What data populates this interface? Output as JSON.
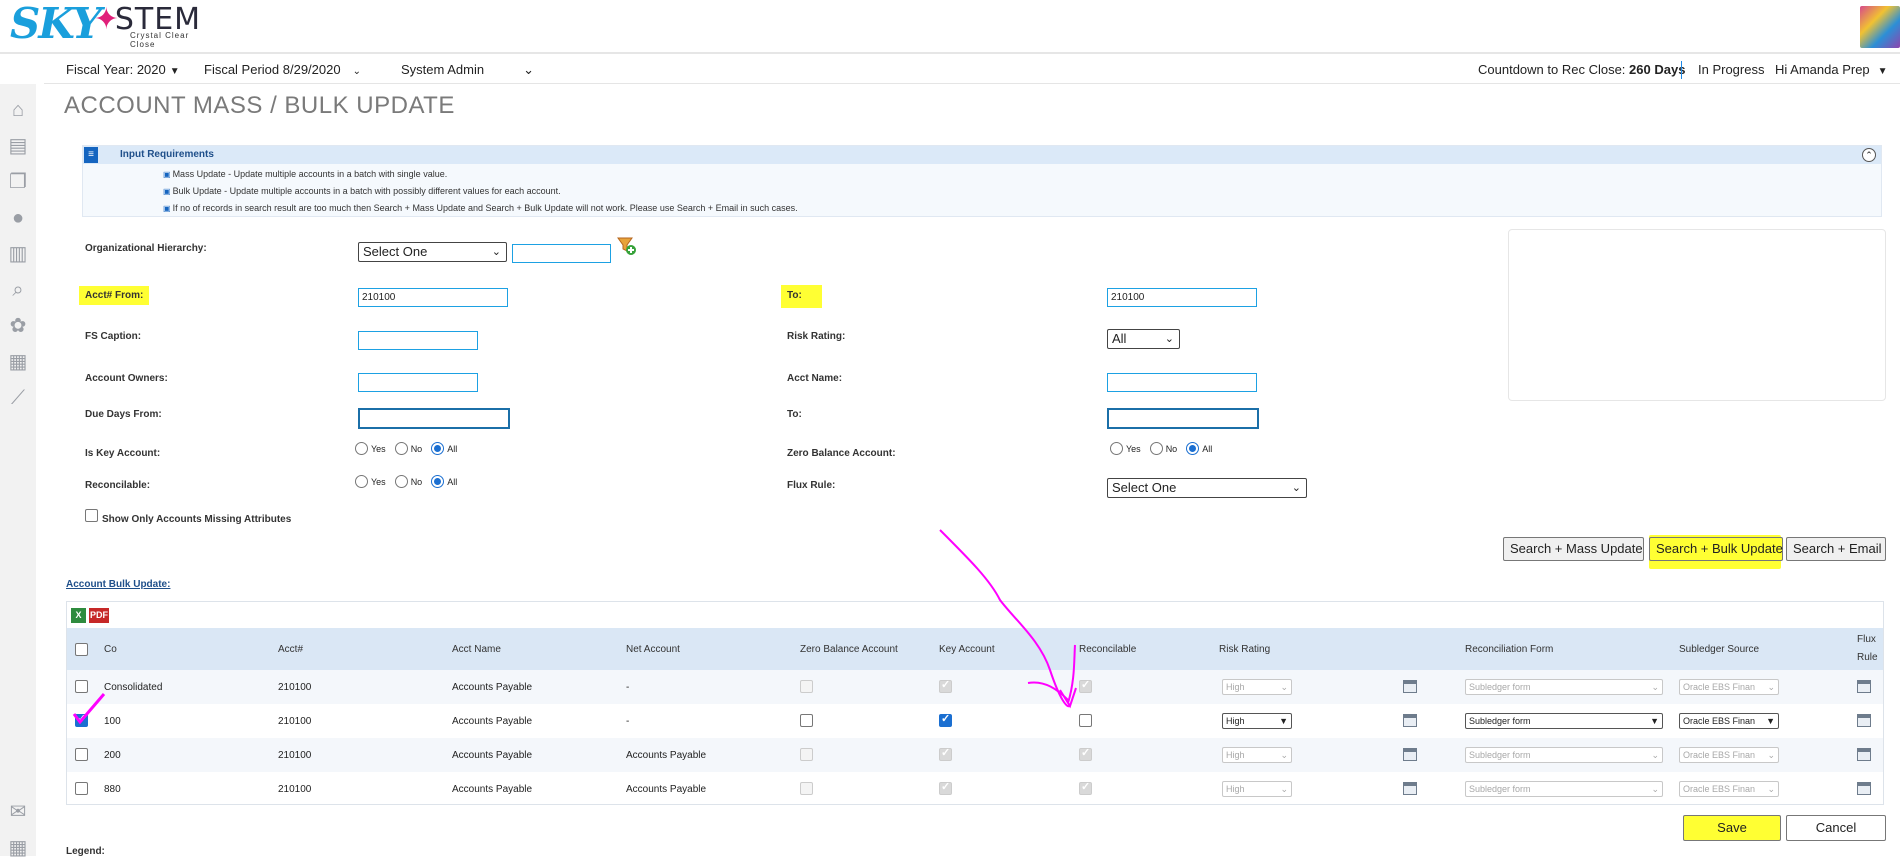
{
  "brand": {
    "logo_part1": "SKY",
    "logo_part2": "STEM",
    "tagline": "Crystal Clear Close"
  },
  "nav": {
    "fiscal_year": "Fiscal Year: 2020",
    "fiscal_period": "Fiscal Period  8/29/2020",
    "role": "System Admin",
    "countdown_label": "Countdown to Rec Close:",
    "countdown_value": "260 Days",
    "status": "In Progress",
    "greeting": "Hi Amanda Prep"
  },
  "page_title": "ACCOUNT MASS / BULK UPDATE",
  "input_requirements": {
    "title": "Input Requirements",
    "lines": [
      "Mass Update - Update multiple accounts in a batch with single value.",
      "Bulk Update - Update multiple accounts in a batch with possibly different values for each account.",
      "If no of records in search result are too much then Search + Mass Update and Search + Bulk Update will not work. Please use Search + Email in such cases."
    ]
  },
  "form": {
    "org_hierarchy_label": "Organizational Hierarchy:",
    "org_hierarchy_value": "Select One",
    "acct_from_label": "Acct# From:",
    "acct_from_value": "210100",
    "acct_to_label": "To:",
    "acct_to_value": "210100",
    "fs_caption_label": "FS Caption:",
    "risk_rating_label": "Risk Rating:",
    "risk_rating_value": "All",
    "account_owners_label": "Account Owners:",
    "acct_name_label": "Acct Name:",
    "due_days_from_label": "Due Days From:",
    "due_days_to_label": "To:",
    "is_key_account_label": "Is Key Account:",
    "zero_balance_label": "Zero Balance Account:",
    "reconcilable_label": "Reconcilable:",
    "flux_rule_label": "Flux Rule:",
    "flux_rule_value": "Select One",
    "radio_yes": "Yes",
    "radio_no": "No",
    "radio_all": "All",
    "missing_attrs_label": "Show Only Accounts Missing Attributes"
  },
  "buttons": {
    "search_mass": "Search + Mass Update",
    "search_bulk": "Search + Bulk Update",
    "search_email": "Search + Email",
    "save": "Save",
    "cancel": "Cancel"
  },
  "grid": {
    "section_title": "Account Bulk Update:",
    "headers": {
      "co": "Co",
      "acct": "Acct#",
      "acct_name": "Acct Name",
      "net_account": "Net Account",
      "zero_balance": "Zero Balance Account",
      "key_account": "Key Account",
      "reconcilable": "Reconcilable",
      "risk_rating": "Risk Rating",
      "rec_form": "Reconciliation Form",
      "subledger_source": "Subledger Source",
      "flux_rule_1": "Flux",
      "flux_rule_2": "Rule"
    },
    "rows": [
      {
        "co": "Consolidated",
        "acct": "210100",
        "acct_name": "Accounts Payable",
        "net_account": "-",
        "risk": "High",
        "rec_form": "Subledger form",
        "subledger": "Oracle EBS Finan"
      },
      {
        "co": "100",
        "acct": "210100",
        "acct_name": "Accounts Payable",
        "net_account": "-",
        "risk": "High",
        "rec_form": "Subledger form",
        "subledger": "Oracle EBS Finan"
      },
      {
        "co": "200",
        "acct": "210100",
        "acct_name": "Accounts Payable",
        "net_account": "Accounts Payable",
        "risk": "High",
        "rec_form": "Subledger form",
        "subledger": "Oracle EBS Finan"
      },
      {
        "co": "880",
        "acct": "210100",
        "acct_name": "Accounts Payable",
        "net_account": "Accounts Payable",
        "risk": "High",
        "rec_form": "Subledger form",
        "subledger": "Oracle EBS Finan"
      }
    ]
  },
  "legend_label": "Legend:",
  "icons": [
    "home-icon",
    "dashboard-icon",
    "documents-icon",
    "user-icon",
    "library-icon",
    "search-report-icon",
    "settings-icon",
    "reports-icon",
    "chart-icon",
    "mail-icon",
    "calendar-icon"
  ],
  "colors": {
    "accent": "#1da1e3",
    "highlight": "#ffff33",
    "annotation": "#ff00ff",
    "title": "#7a7a7a"
  }
}
